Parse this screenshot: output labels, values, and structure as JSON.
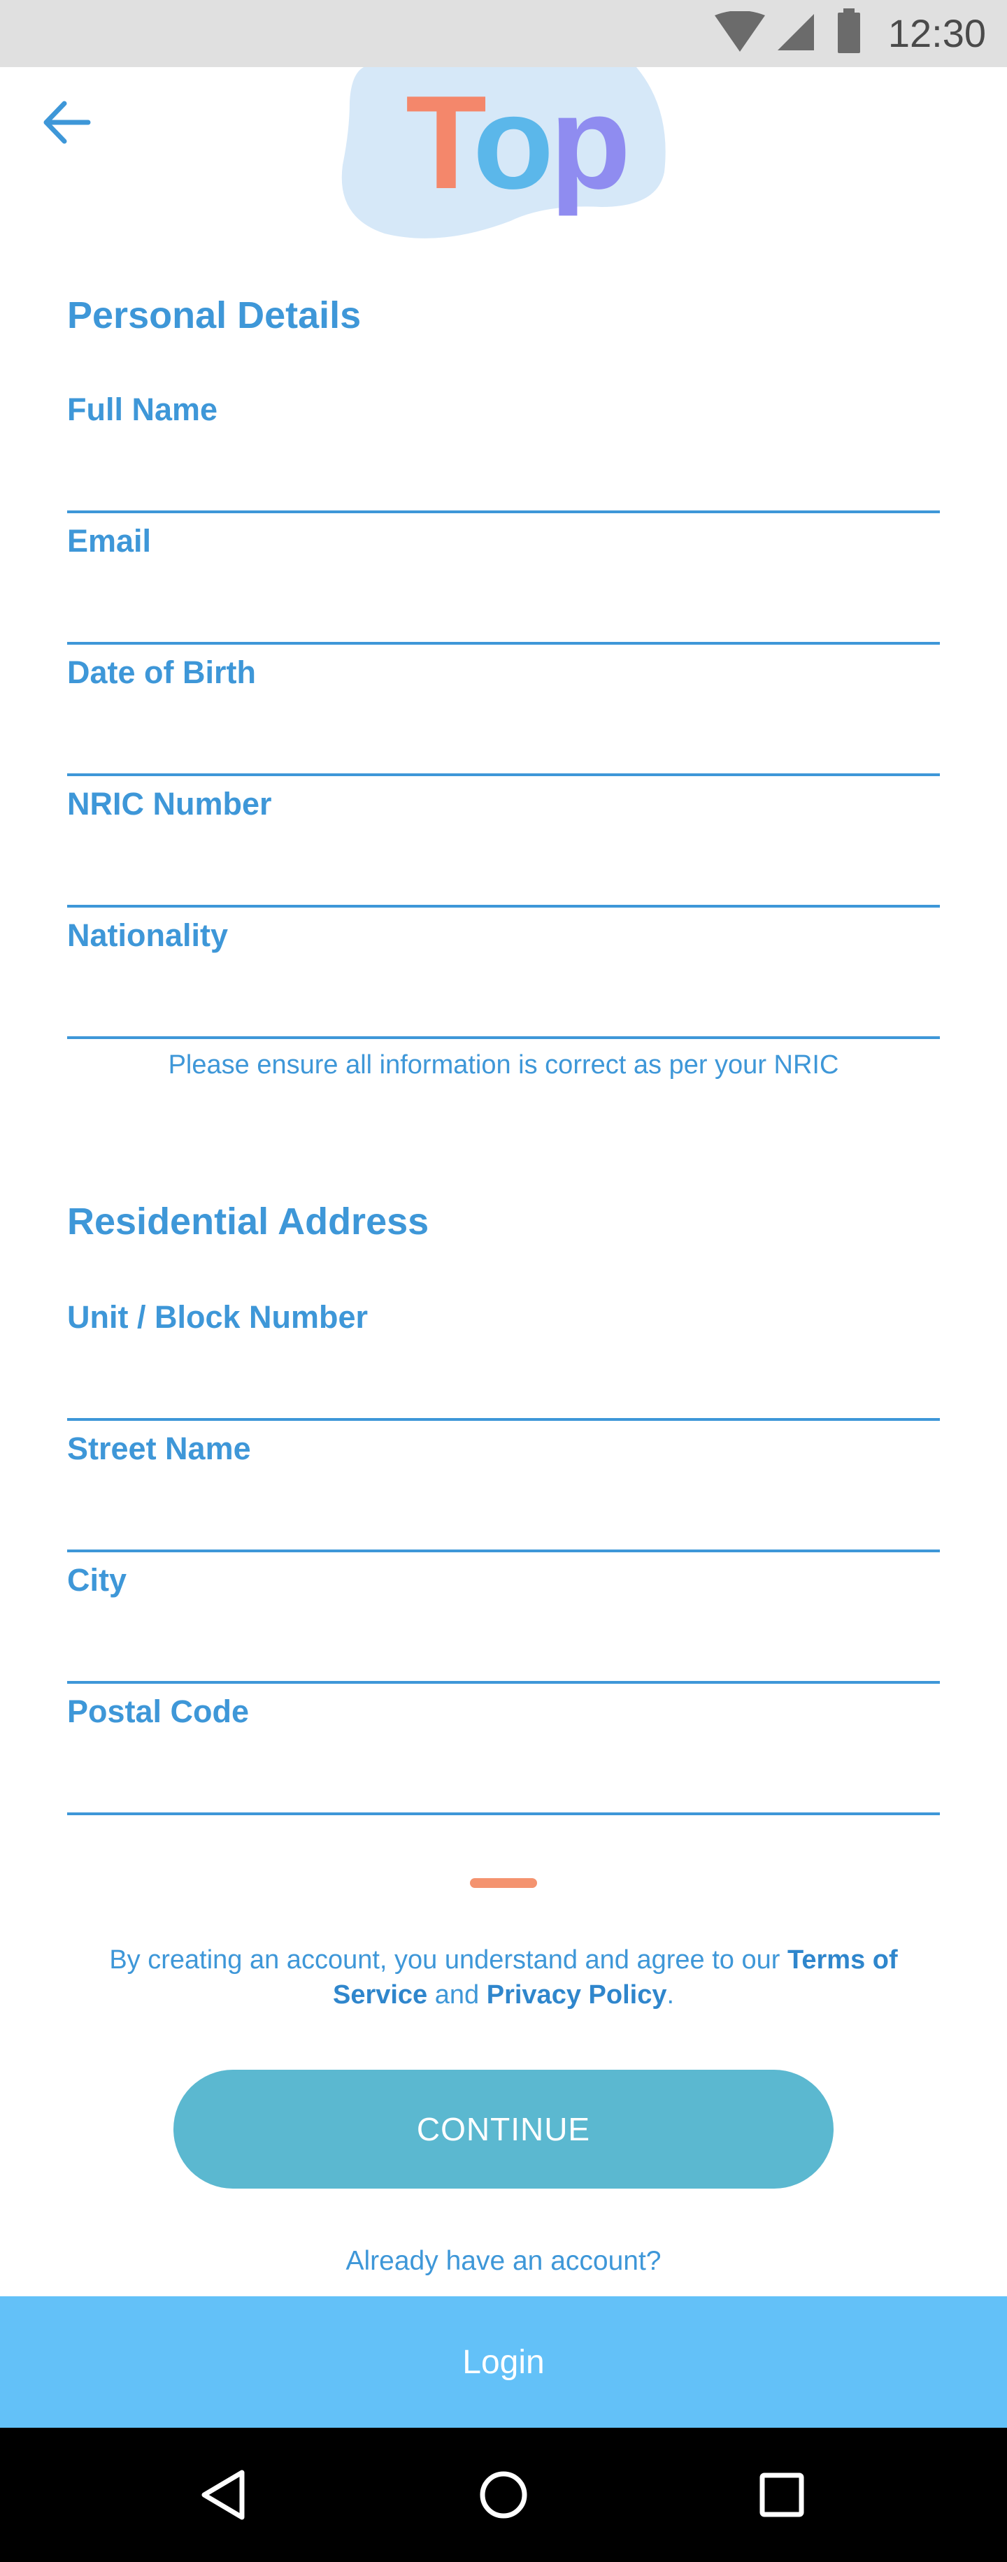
{
  "status_bar": {
    "time": "12:30",
    "icons": [
      "wifi-icon",
      "signal-icon",
      "battery-icon"
    ]
  },
  "header": {
    "back_icon": "arrow-left-icon",
    "logo_text": {
      "t": "T",
      "o": "o",
      "p": "p"
    }
  },
  "personal": {
    "title": "Personal Details",
    "fields": [
      {
        "label": "Full Name",
        "value": ""
      },
      {
        "label": "Email",
        "value": ""
      },
      {
        "label": "Date of Birth",
        "value": ""
      },
      {
        "label": "NRIC Number",
        "value": ""
      },
      {
        "label": "Nationality",
        "value": ""
      }
    ],
    "note": "Please ensure all information is correct as per your NRIC"
  },
  "address": {
    "title": "Residential Address",
    "fields": [
      {
        "label": "Unit / Block Number",
        "value": ""
      },
      {
        "label": "Street Name",
        "value": ""
      },
      {
        "label": "City",
        "value": ""
      },
      {
        "label": "Postal Code",
        "value": ""
      }
    ]
  },
  "terms": {
    "prefix": "By creating an account, you understand and agree to our ",
    "terms_link": "Terms of Service",
    "middle": " and ",
    "privacy_link": "Privacy Policy",
    "suffix": "."
  },
  "buttons": {
    "continue": "CONTINUE",
    "already": "Already have an account?",
    "login": "Login"
  },
  "colors": {
    "primary": "#3e97d8",
    "button": "#5bb8d0",
    "login_bar": "#63c1f8",
    "accent": "#f4936f"
  },
  "nav": {
    "icons": [
      "nav-back-icon",
      "nav-home-icon",
      "nav-recents-icon"
    ]
  }
}
